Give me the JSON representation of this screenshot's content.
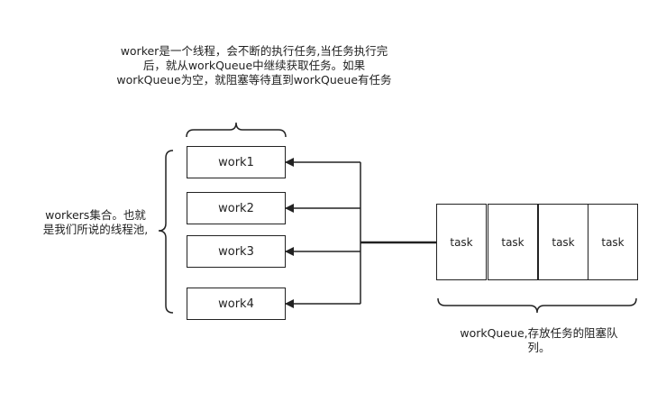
{
  "notes": {
    "worker_note": "worker是一个线程，会不断的执行任务,当任务执行完后，就从workQueue中继续获取任务。如果workQueue为空，就阻塞等待直到workQueue有任务",
    "workers_note": "workers集合。也就是我们所说的线程池,",
    "queue_note": "workQueue,存放任务的阻塞队列。"
  },
  "workers": [
    {
      "label": "work1"
    },
    {
      "label": "work2"
    },
    {
      "label": "work3"
    },
    {
      "label": "work4"
    }
  ],
  "tasks": [
    {
      "label": "task"
    },
    {
      "label": "task"
    },
    {
      "label": "task"
    },
    {
      "label": "task"
    }
  ],
  "colors": {
    "stroke": "#222222",
    "background": "#ffffff"
  }
}
